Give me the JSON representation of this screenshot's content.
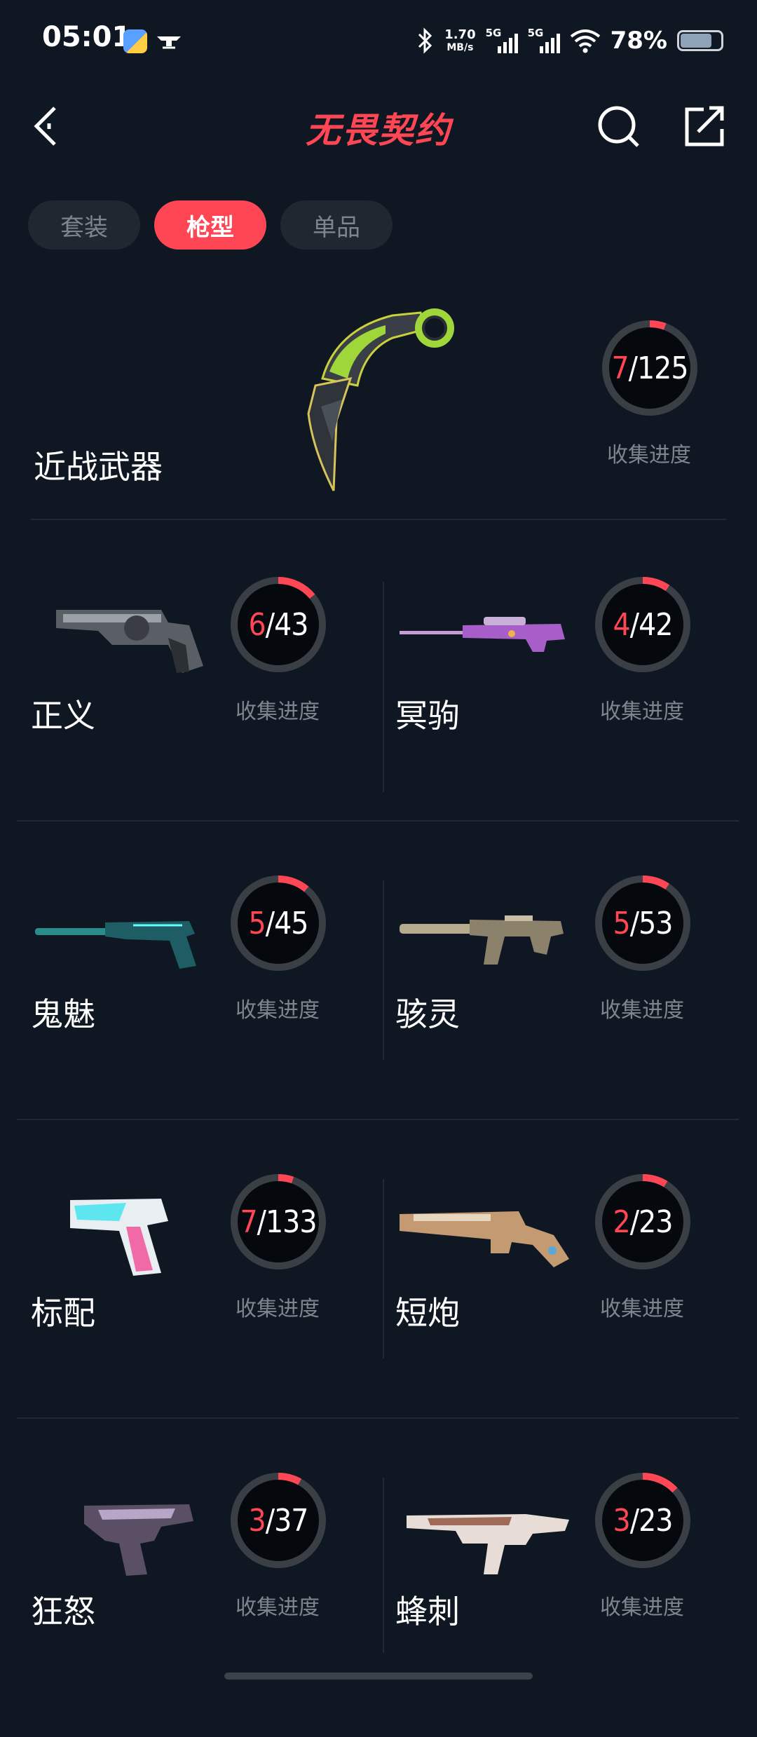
{
  "status_bar": {
    "time": "05:01",
    "net_speed": "1.70",
    "net_unit": "MB/s",
    "sim1": "5G",
    "sim2": "5G",
    "battery": "78%",
    "battery_level": 0.78,
    "icons": [
      "bluetooth-icon",
      "wifi-icon",
      "battery-icon"
    ]
  },
  "header": {
    "title": "无畏契约",
    "title_color": "#ff4655",
    "icons": [
      "back-arrow-icon",
      "search-icon",
      "share-icon"
    ]
  },
  "tabs": [
    {
      "label": "套装",
      "active": false
    },
    {
      "label": "枪型",
      "active": true
    },
    {
      "label": "单品",
      "active": false
    }
  ],
  "progress_label": "收集进度",
  "melee": {
    "name": "近战武器",
    "collected": "7",
    "total": "/125",
    "fraction": 0.056
  },
  "weapons": [
    {
      "name": "正义",
      "collected": "6",
      "total": "/43",
      "fraction": 0.14
    },
    {
      "name": "冥驹",
      "collected": "4",
      "total": "/42",
      "fraction": 0.095
    },
    {
      "name": "鬼魅",
      "collected": "5",
      "total": "/45",
      "fraction": 0.11
    },
    {
      "name": "骇灵",
      "collected": "5",
      "total": "/53",
      "fraction": 0.094
    },
    {
      "name": "标配",
      "collected": "7",
      "total": "/133",
      "fraction": 0.053
    },
    {
      "name": "短炮",
      "collected": "2",
      "total": "/23",
      "fraction": 0.087
    },
    {
      "name": "狂怒",
      "collected": "3",
      "total": "/37",
      "fraction": 0.081
    },
    {
      "name": "蜂刺",
      "collected": "3",
      "total": "/23",
      "fraction": 0.13
    }
  ],
  "colors": {
    "background": "#0f1822",
    "accent": "#ff4655",
    "muted": "#7d858e"
  }
}
